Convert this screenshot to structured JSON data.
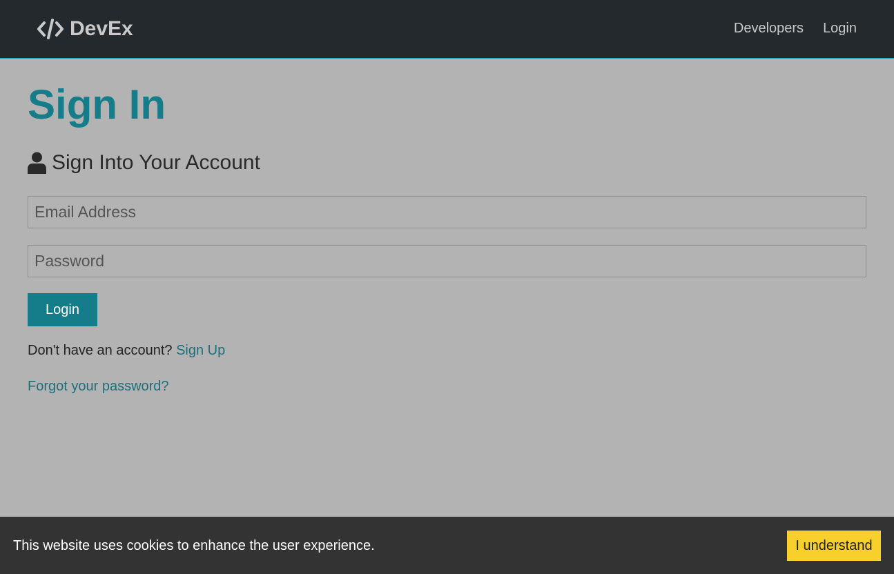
{
  "navbar": {
    "brand": "DevEx",
    "brand_icon": "code-icon",
    "links": [
      {
        "label": "Developers"
      },
      {
        "label": "Login"
      }
    ]
  },
  "main": {
    "title": "Sign In",
    "subtitle_icon": "user-icon",
    "subtitle": "Sign Into Your Account",
    "email_placeholder": "Email Address",
    "email_value": "",
    "password_placeholder": "Password",
    "password_value": "",
    "login_button": "Login",
    "signup_prompt": "Don't have an account?",
    "signup_link": "Sign Up",
    "forgot_link": "Forgot your password?"
  },
  "cookie_banner": {
    "message": "This website uses cookies to enhance the user experience.",
    "button": "I understand"
  },
  "colors": {
    "navbar_bg": "#24292e",
    "page_bg": "#b3b3b3",
    "accent": "#157d8a",
    "cookie_bg": "#333333",
    "cookie_button": "#f7d02c"
  }
}
